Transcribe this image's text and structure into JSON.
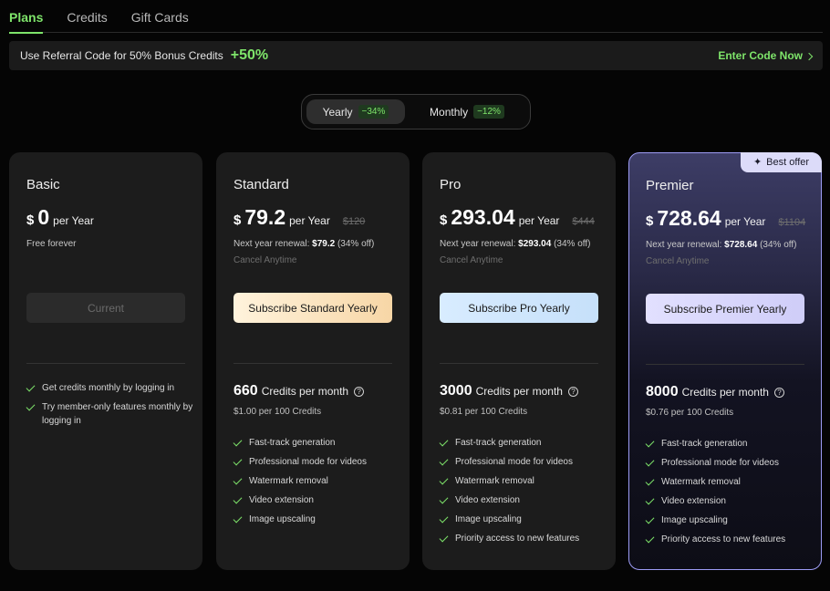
{
  "tabs": [
    "Plans",
    "Credits",
    "Gift Cards"
  ],
  "referral": {
    "text": "Use Referral Code for 50% Bonus Credits",
    "bonus": "+50%",
    "link": "Enter Code Now"
  },
  "billing": {
    "yearly_label": "Yearly",
    "yearly_discount": "−34%",
    "monthly_label": "Monthly",
    "monthly_discount": "−12%",
    "selected": "Yearly"
  },
  "colors": {
    "accent": "#7ee46a",
    "premier_border": "#9d9cf5"
  },
  "plans": {
    "basic": {
      "name": "Basic",
      "currency": "$",
      "price": "0",
      "period": "per Year",
      "note": "Free forever",
      "cta": "Current",
      "features": [
        "Get credits monthly by logging in",
        "Try member-only features monthly by logging in"
      ]
    },
    "standard": {
      "name": "Standard",
      "currency": "$",
      "price": "79.2",
      "period": "per Year",
      "old_price": "$120",
      "renewal_prefix": "Next year renewal: ",
      "renewal_amount": "$79.2",
      "renewal_suffix": " (34% off)",
      "cancel": "Cancel Anytime",
      "cta": "Subscribe Standard Yearly",
      "credits": "660",
      "credits_label": "Credits per month",
      "per100": "$1.00 per 100 Credits",
      "features": [
        "Fast-track generation",
        "Professional mode for videos",
        "Watermark removal",
        "Video extension",
        "Image upscaling"
      ]
    },
    "pro": {
      "name": "Pro",
      "currency": "$",
      "price": "293.04",
      "period": "per Year",
      "old_price": "$444",
      "renewal_prefix": "Next year renewal: ",
      "renewal_amount": "$293.04",
      "renewal_suffix": " (34% off)",
      "cancel": "Cancel Anytime",
      "cta": "Subscribe Pro Yearly",
      "credits": "3000",
      "credits_label": "Credits per month",
      "per100": "$0.81 per 100 Credits",
      "features": [
        "Fast-track generation",
        "Professional mode for videos",
        "Watermark removal",
        "Video extension",
        "Image upscaling",
        "Priority access to new features"
      ]
    },
    "premier": {
      "name": "Premier",
      "badge": "Best offer",
      "currency": "$",
      "price": "728.64",
      "period": "per Year",
      "old_price": "$1104",
      "renewal_prefix": "Next year renewal: ",
      "renewal_amount": "$728.64",
      "renewal_suffix": " (34% off)",
      "cancel": "Cancel Anytime",
      "cta": "Subscribe Premier Yearly",
      "credits": "8000",
      "credits_label": "Credits per month",
      "per100": "$0.76 per 100 Credits",
      "features": [
        "Fast-track generation",
        "Professional mode for videos",
        "Watermark removal",
        "Video extension",
        "Image upscaling",
        "Priority access to new features"
      ]
    }
  }
}
